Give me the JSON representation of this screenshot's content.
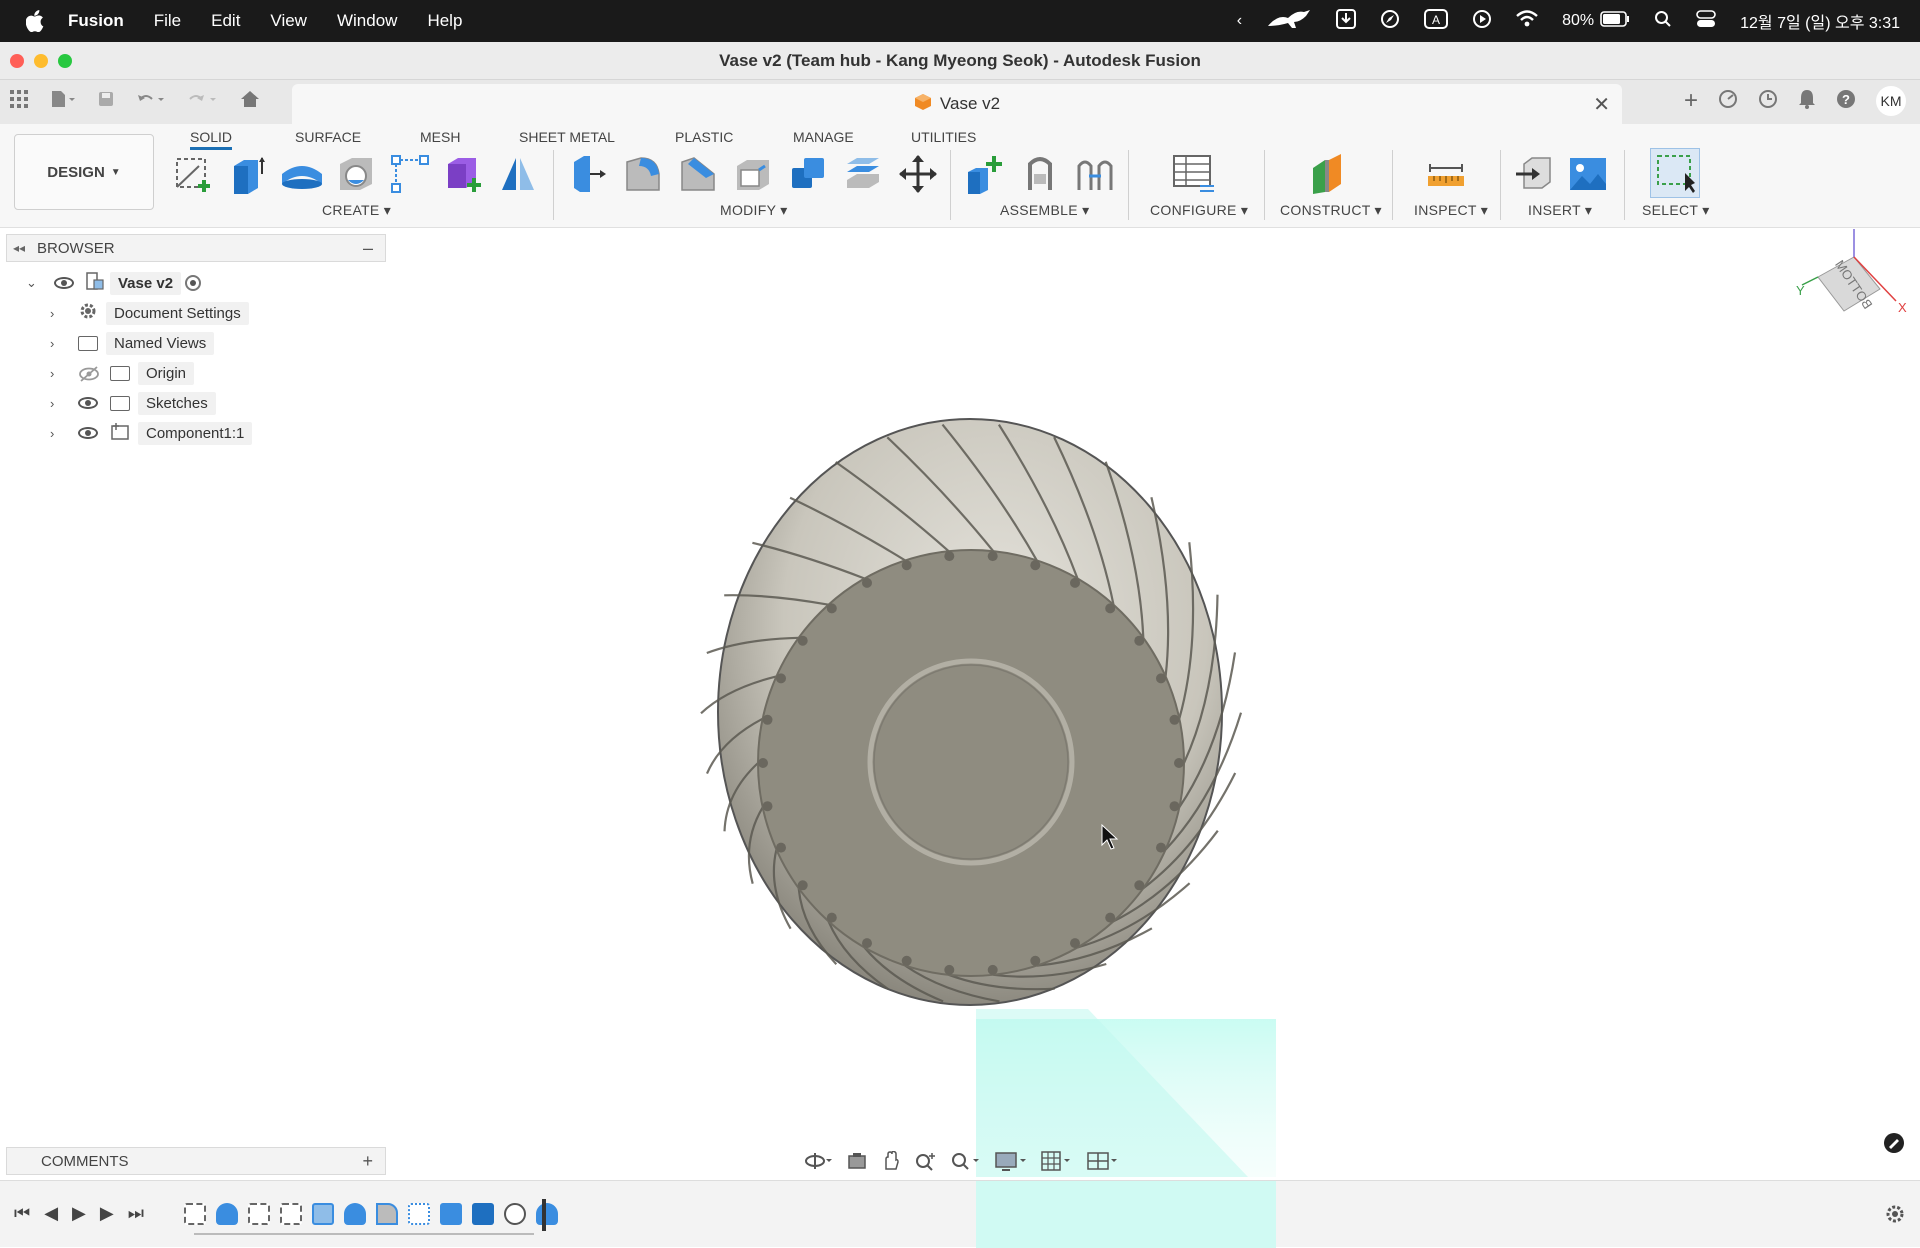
{
  "menubar": {
    "app": "Fusion",
    "items": [
      "File",
      "Edit",
      "View",
      "Window",
      "Help"
    ],
    "battery": "80%",
    "datetime": "12월 7일 (일) 오후 3:31"
  },
  "window": {
    "title": "Vase v2 (Team hub - Kang Myeong Seok) - Autodesk Fusion"
  },
  "document_tab": {
    "label": "Vase v2"
  },
  "user": {
    "initials": "KM"
  },
  "workspace": {
    "label": "DESIGN"
  },
  "toolbar_tabs": [
    "SOLID",
    "SURFACE",
    "MESH",
    "SHEET METAL",
    "PLASTIC",
    "MANAGE",
    "UTILITIES"
  ],
  "groups": {
    "create": "CREATE",
    "modify": "MODIFY",
    "assemble": "ASSEMBLE",
    "configure": "CONFIGURE",
    "construct": "CONSTRUCT",
    "inspect": "INSPECT",
    "insert": "INSERT",
    "select": "SELECT"
  },
  "browser": {
    "title": "BROWSER",
    "root": "Vase v2",
    "items": [
      "Document Settings",
      "Named Views",
      "Origin",
      "Sketches",
      "Component1:1"
    ]
  },
  "viewcube": {
    "face": "BOTTOM",
    "axes": [
      "Z",
      "Y",
      "X"
    ]
  },
  "comments": {
    "title": "COMMENTS"
  },
  "colors": {
    "accent": "#1b6fb4",
    "model": "#8f8c80",
    "highlight": "#bff7ee"
  }
}
